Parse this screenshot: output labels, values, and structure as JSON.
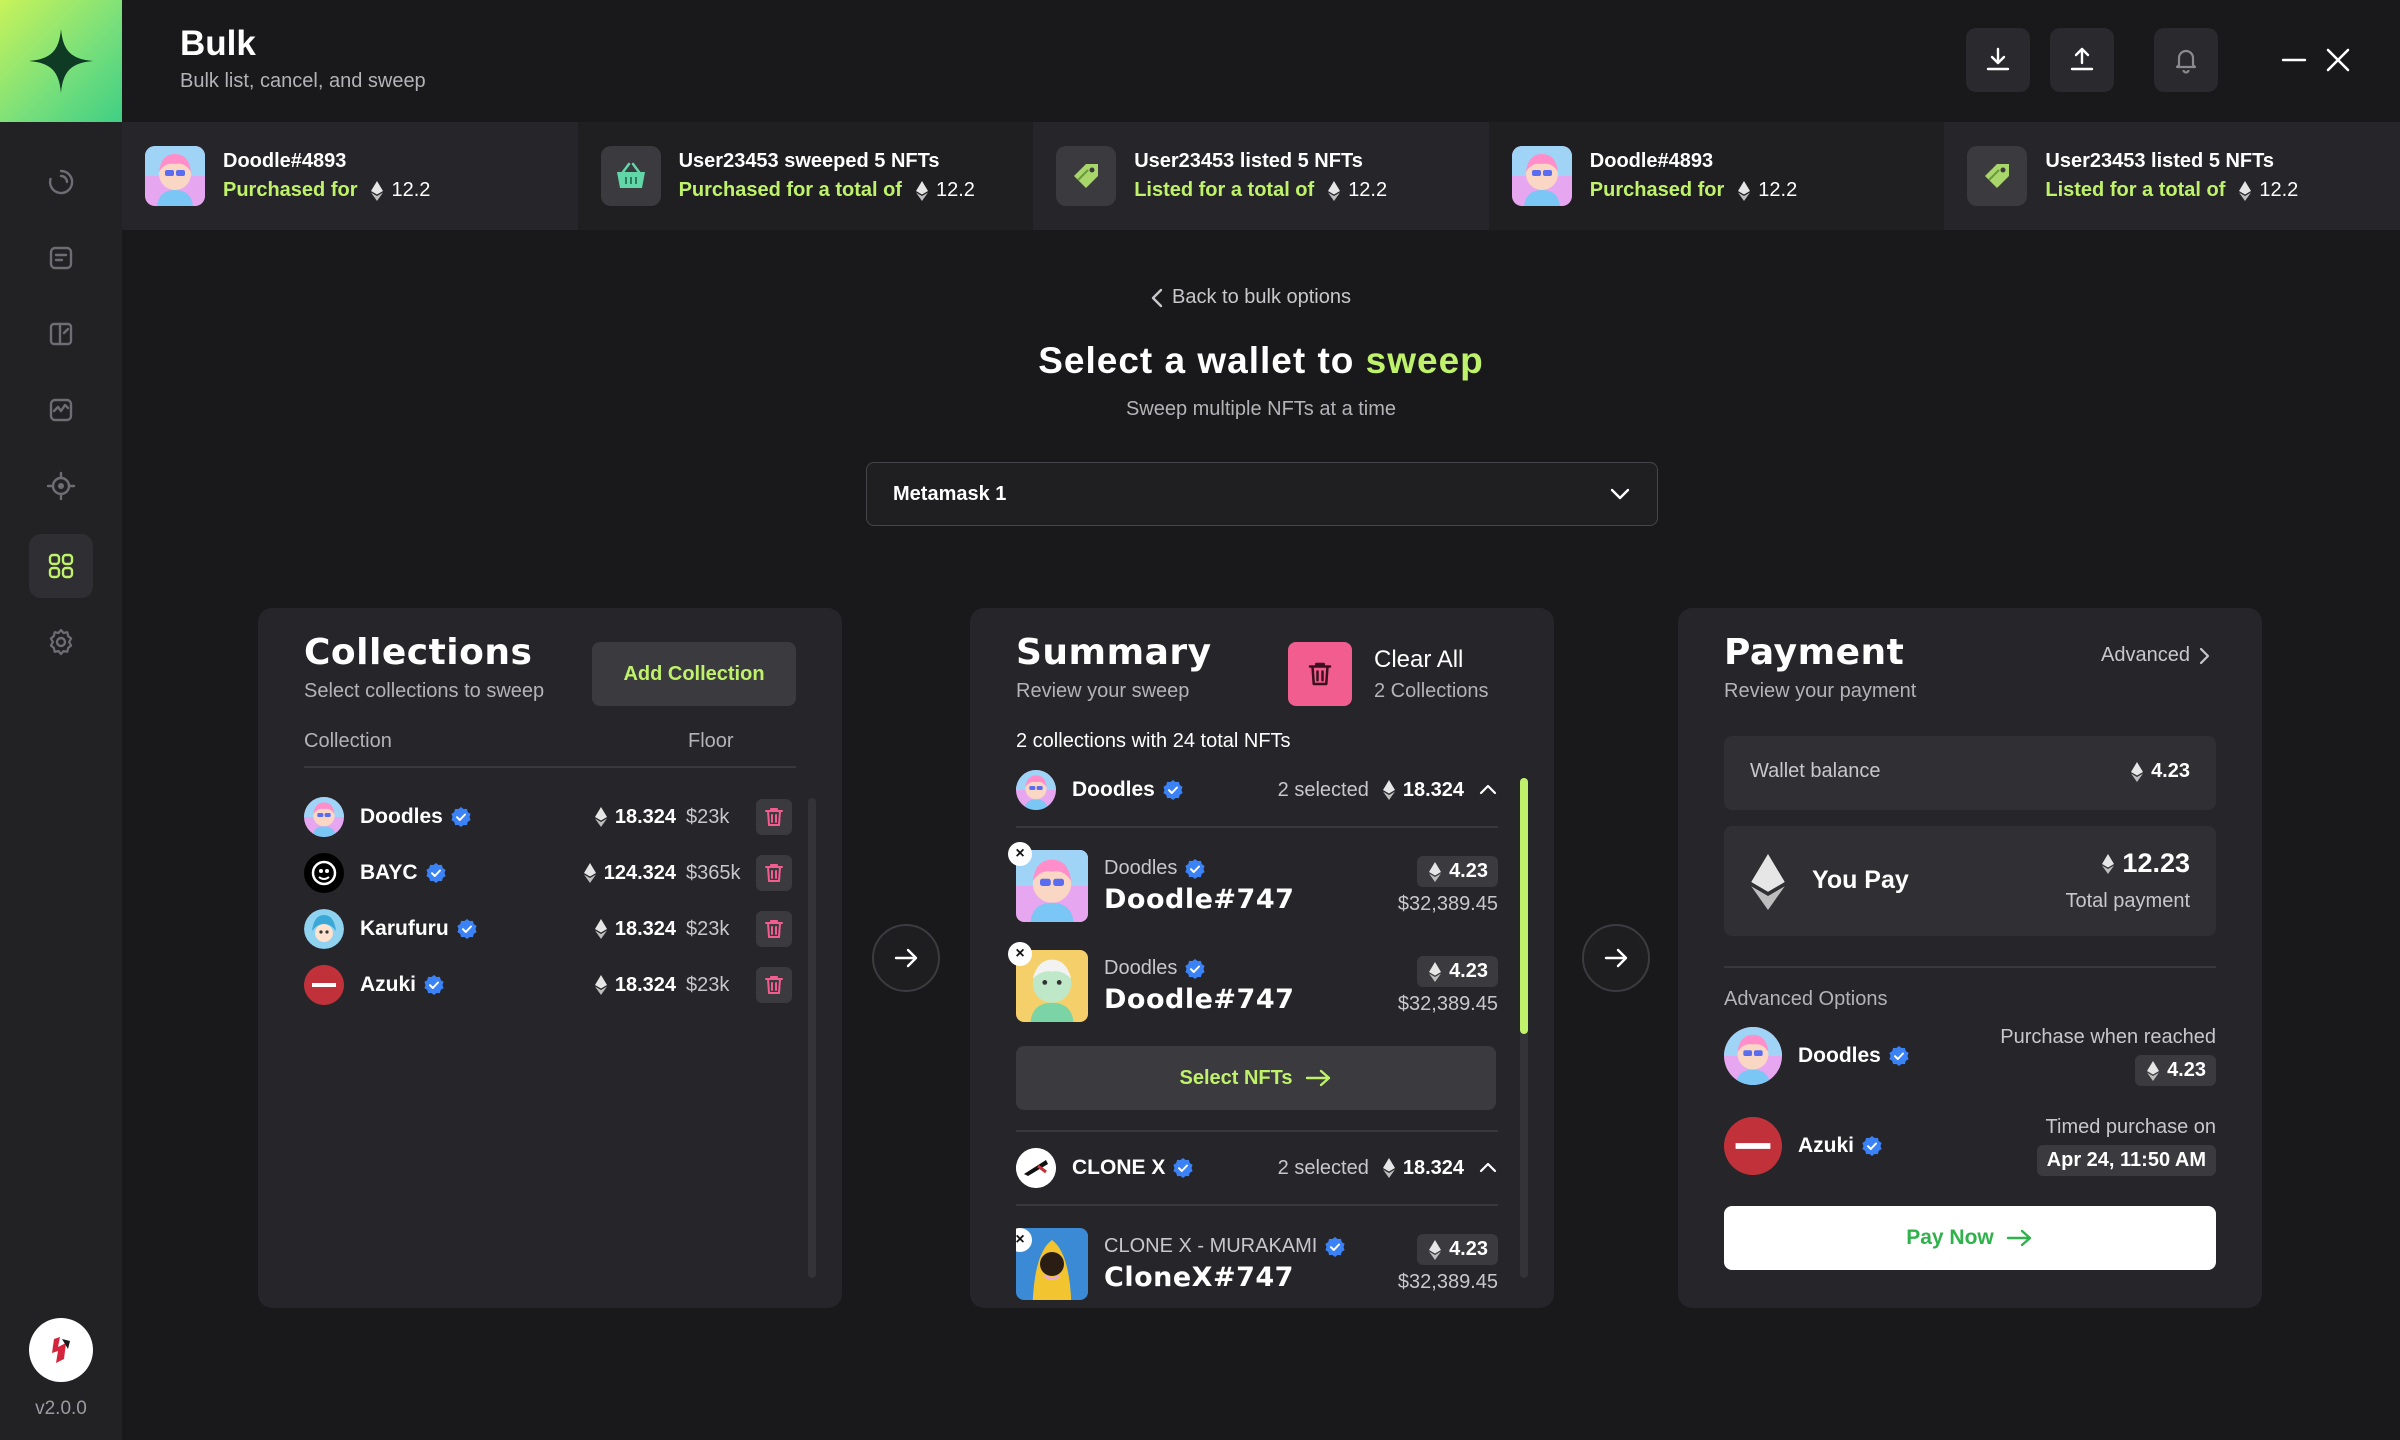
{
  "app": {
    "title": "Bulk",
    "subtitle": "Bulk list, cancel, and sweep",
    "version": "v2.0.0"
  },
  "sidebar": {
    "items": [
      {
        "name": "history-icon",
        "active": false
      },
      {
        "name": "orders-icon",
        "active": false
      },
      {
        "name": "portfolio-icon",
        "active": false
      },
      {
        "name": "activity-icon",
        "active": false
      },
      {
        "name": "target-icon",
        "active": false
      },
      {
        "name": "bulk-grid-icon",
        "active": true
      },
      {
        "name": "settings-icon",
        "active": false
      }
    ]
  },
  "activity": [
    {
      "title": "Doodle#4893",
      "label": "Purchased for",
      "value": "12.2",
      "thumb": "doodle"
    },
    {
      "title": "User23453 sweeped 5 NFTs",
      "label": "Purchased for a total of",
      "value": "12.2",
      "thumb": "basket"
    },
    {
      "title": "User23453 listed 5 NFTs",
      "label": "Listed for a total of",
      "value": "12.2",
      "thumb": "tag"
    },
    {
      "title": "Doodle#4893",
      "label": "Purchased for",
      "value": "12.2",
      "thumb": "doodle"
    },
    {
      "title": "User23453 listed 5 NFTs",
      "label": "Listed for a total of",
      "value": "12.2",
      "thumb": "tag"
    }
  ],
  "main": {
    "back_label": "Back to bulk options",
    "title_prefix": "Select a wallet to",
    "title_highlight": "sweep",
    "subtitle": "Sweep multiple NFTs at a time",
    "wallet": "Metamask 1"
  },
  "collections": {
    "title": "Collections",
    "subtitle": "Select collections to sweep",
    "add_label": "Add Collection",
    "col_collection": "Collection",
    "col_floor": "Floor",
    "items": [
      {
        "name": "Doodles",
        "floor": "18.324",
        "usd": "$23k"
      },
      {
        "name": "BAYC",
        "floor": "124.324",
        "usd": "$365k"
      },
      {
        "name": "Karufuru",
        "floor": "18.324",
        "usd": "$23k"
      },
      {
        "name": "Azuki",
        "floor": "18.324",
        "usd": "$23k"
      }
    ]
  },
  "summary": {
    "title": "Summary",
    "subtitle": "Review your sweep",
    "clear_label": "Clear All",
    "clear_sub": "2 Collections",
    "count_text": "2 collections with 24 total NFTs",
    "groups": [
      {
        "name": "Doodles",
        "selected": "2 selected",
        "price": "18.324"
      },
      {
        "name": "CLONE X",
        "selected": "2 selected",
        "price": "18.324"
      }
    ],
    "nfts": [
      {
        "collection": "Doodles",
        "name": "Doodle#747",
        "price": "4.23",
        "usd": "$32,389.45"
      },
      {
        "collection": "Doodles",
        "name": "Doodle#747",
        "price": "4.23",
        "usd": "$32,389.45"
      },
      {
        "collection": "CLONE X - MURAKAMI",
        "name": "CloneX#747",
        "price": "4.23",
        "usd": "$32,389.45"
      }
    ],
    "select_label": "Select NFTs"
  },
  "payment": {
    "title": "Payment",
    "subtitle": "Review your payment",
    "advanced_link": "Advanced",
    "wallet_balance_label": "Wallet balance",
    "wallet_balance": "4.23",
    "you_pay_label": "You Pay",
    "you_pay": "12.23",
    "total_label": "Total payment",
    "advanced_title": "Advanced Options",
    "options": [
      {
        "name": "Doodles",
        "label": "Purchase when reached",
        "value": "4.23"
      },
      {
        "name": "Azuki",
        "label": "Timed purchase on",
        "value": "Apr 24, 11:50 AM"
      }
    ],
    "pay_label": "Pay Now"
  },
  "colors": {
    "accent": "#bff26a",
    "danger": "#f25d8f",
    "verified": "#3b82f6",
    "pay_text": "#2fb24c"
  }
}
